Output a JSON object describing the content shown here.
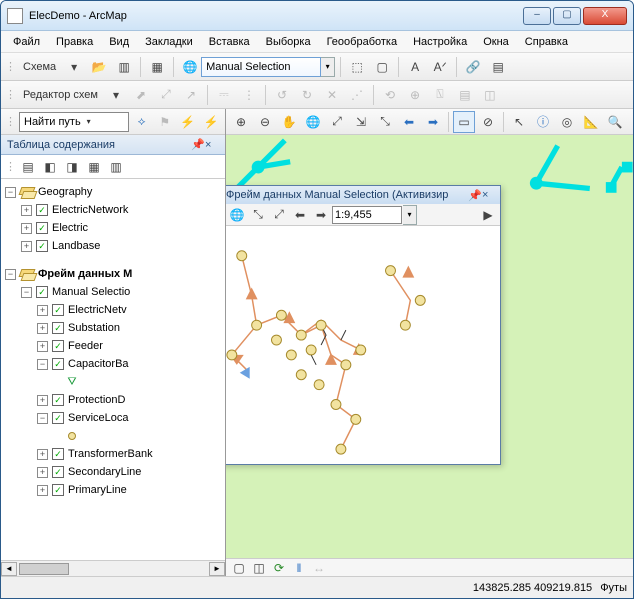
{
  "window": {
    "title": "ElecDemo - ArcMap",
    "btn_min": "–",
    "btn_max": "▢",
    "btn_close": "X"
  },
  "menubar": [
    "Файл",
    "Правка",
    "Вид",
    "Закладки",
    "Вставка",
    "Выборка",
    "Геообработка",
    "Настройка",
    "Окна",
    "Справка"
  ],
  "toolbar1": {
    "schema_label": "Схема",
    "schema_arrow": "▾",
    "selection_combo": "Manual Selection",
    "icons": {
      "open": "📂",
      "new": "▥",
      "layout": "▦",
      "globe": "🌐",
      "frame1": "⬚",
      "frame2": "▢",
      "text1": "A",
      "text2": "Aᐟ",
      "chain": "🔗",
      "layers": "▤"
    }
  },
  "toolbar2": {
    "editor_label": "Редактор схем",
    "editor_arrow": "▾",
    "icons": {
      "i1": "⬈",
      "i2": "⤢",
      "i3": "↗",
      "i4": "⎓",
      "i5": "⋮",
      "i6": "↺",
      "i7": "↻",
      "i8": "✕",
      "i9": "⋰",
      "i10": "⟲",
      "i11": "⊕",
      "i12": "⍂",
      "i13": "▤",
      "i14": "◫"
    }
  },
  "toolbar3": {
    "find_combo": "Найти путь",
    "icons": {
      "route": "⟡",
      "flag": "⚑",
      "bolt1": "⚡",
      "bolt2": "⚡"
    }
  },
  "mapnav": {
    "icons": {
      "zoomin": "⊕",
      "zoomout": "⊖",
      "pan": "✋",
      "globe": "🌐",
      "full": "⤢",
      "zfix1": "⇲",
      "zfix2": "⤡",
      "back": "⬅",
      "fwd": "➡",
      "sel": "▭",
      "clear": "⊘",
      "ptr": "↖",
      "info": "ⓘ",
      "ident": "◎",
      "meas": "📐",
      "find": "🔍",
      "goto": "➣",
      "more": "⋯"
    }
  },
  "toc": {
    "title": "Таблица содержания",
    "pin": "📌",
    "close": "×",
    "toolicons": {
      "i1": "▤",
      "i2": "◧",
      "i3": "◨",
      "i4": "▦",
      "i5": "▥"
    },
    "tree": {
      "geography": "Geography",
      "electricnetwork": "ElectricNetwork",
      "electric": "Electric",
      "landbase": "Landbase",
      "frame": "Фрейм данных M",
      "manualsel": "Manual Selectio",
      "electricnetv": "ElectricNetv",
      "substation": "Substation",
      "feeder": "Feeder",
      "capacitorba": "CapacitorBa",
      "protectiond": "ProtectionD",
      "serviceloca": "ServiceLoca",
      "transformerbank": "TransformerBank",
      "secondaryline": "SecondaryLine",
      "primaryline": "PrimaryLine"
    }
  },
  "overview": {
    "title": "Просмотр - Фрейм данных Manual Selection  (Активизир",
    "scale": "1:9,455",
    "close": "×",
    "icons": {
      "zi": "⊕",
      "zo": "⊖",
      "pan": "✋",
      "globe": "🌐",
      "full": "⤡",
      "fit": "⤢",
      "back": "⬅",
      "fwd": "➡",
      "run": "▶"
    }
  },
  "status": {
    "coords": "143825.285  409219.815",
    "units": "Футы",
    "toolicons": {
      "i1": "▢",
      "i2": "◫",
      "i3": "⟳",
      "i4": "‖",
      "i5": "↔"
    }
  },
  "scroll": {
    "left": "◄",
    "right": "►"
  }
}
